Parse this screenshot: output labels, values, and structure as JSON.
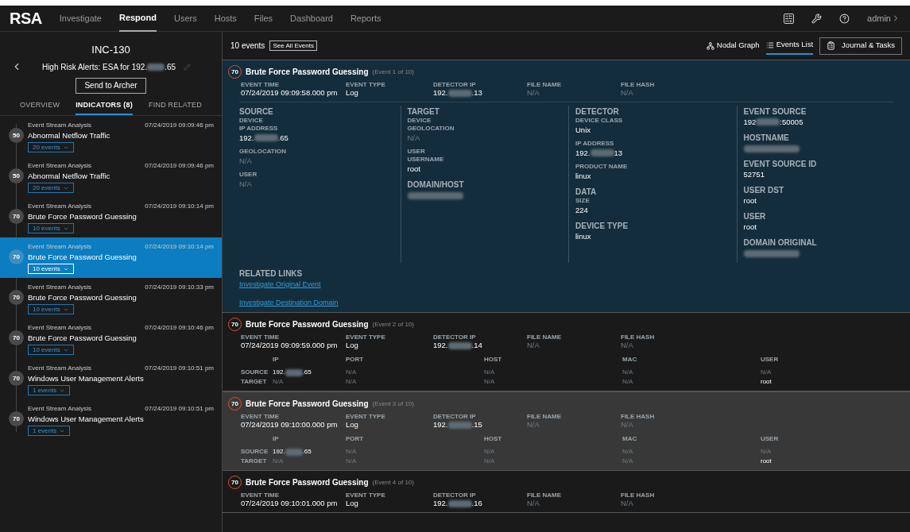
{
  "nav": {
    "logo": "RSA",
    "items": [
      {
        "label": "Investigate",
        "selected": false
      },
      {
        "label": "Respond",
        "selected": true
      },
      {
        "label": "Users",
        "selected": false
      },
      {
        "label": "Hosts",
        "selected": false
      },
      {
        "label": "Files",
        "selected": false
      },
      {
        "label": "Dashboard",
        "selected": false
      },
      {
        "label": "Reports",
        "selected": false
      }
    ],
    "user": "admin"
  },
  "incident": {
    "id": "INC-130",
    "title_prefix": "High Risk Alerts: ESA for 192.",
    "title_suffix": ".65",
    "button": "Send to Archer",
    "tabs": [
      {
        "label": "OVERVIEW",
        "selected": false
      },
      {
        "label": "INDICATORS (8)",
        "selected": true
      },
      {
        "label": "FIND RELATED",
        "selected": false
      }
    ]
  },
  "indicators": [
    {
      "source": "Event Stream Analysis",
      "time": "07/24/2019 09:09:46 pm",
      "score": "50",
      "name": "Abnormal Netflow Traffic",
      "events": "20 events",
      "selected": false
    },
    {
      "source": "Event Stream Analysis",
      "time": "07/24/2019 09:09:46 pm",
      "score": "50",
      "name": "Abnormal Netflow Traffic",
      "events": "20 events",
      "selected": false
    },
    {
      "source": "Event Stream Analysis",
      "time": "07/24/2019 09:10:14 pm",
      "score": "70",
      "name": "Brute Force Password Guessing",
      "events": "10 events",
      "selected": false
    },
    {
      "source": "Event Stream Analysis",
      "time": "07/24/2019 09:10:14 pm",
      "score": "70",
      "name": "Brute Force Password Guessing",
      "events": "10 events",
      "selected": true
    },
    {
      "source": "Event Stream Analysis",
      "time": "07/24/2019 09:10:33 pm",
      "score": "70",
      "name": "Brute Force Password Guessing",
      "events": "10 events",
      "selected": false
    },
    {
      "source": "Event Stream Analysis",
      "time": "07/24/2019 09:10:46 pm",
      "score": "70",
      "name": "Brute Force Password Guessing",
      "events": "10 events",
      "selected": false
    },
    {
      "source": "Event Stream Analysis",
      "time": "07/24/2019 09:10:51 pm",
      "score": "70",
      "name": "Windows User Management Alerts",
      "events": "1 events",
      "selected": false
    },
    {
      "source": "Event Stream Analysis",
      "time": "07/24/2019 09:10:51 pm",
      "score": "70",
      "name": "Windows User Management Alerts",
      "events": "1 events",
      "selected": false
    }
  ],
  "events_header": {
    "count": "10 events",
    "see_all": "See All Events",
    "views": [
      {
        "label": "Nodal Graph",
        "kind": "graph",
        "selected": false
      },
      {
        "label": "Events List",
        "kind": "list",
        "selected": true
      }
    ],
    "journal": "Journal & Tasks"
  },
  "events": [
    {
      "score": "70",
      "title": "Brute Force Password Guessing",
      "position": "(Event 1 of 10)",
      "expanded": true,
      "highlighted": false,
      "fields": [
        {
          "label": "EVENT TIME",
          "value": {
            "kind": "value",
            "text": "07/24/2019 09:09:58.000 pm"
          }
        },
        {
          "label": "EVENT TYPE",
          "value": {
            "kind": "value",
            "text": "Log"
          }
        },
        {
          "label": "DETECTOR IP",
          "value": {
            "kind": "ip",
            "prefix": "192.",
            "suffix": ".13"
          }
        },
        {
          "label": "FILE NAME",
          "value": {
            "kind": "na",
            "text": "N/A"
          }
        },
        {
          "label": "FILE HASH",
          "value": {
            "kind": "na",
            "text": "N/A"
          }
        }
      ],
      "details": [
        [
          {
            "kind": "section",
            "text": "SOURCE"
          },
          {
            "kind": "label",
            "text": "DEVICE"
          },
          {
            "kind": "label",
            "text": "IP ADDRESS"
          },
          {
            "kind": "ip",
            "prefix": "192.",
            "suffix": ".65"
          },
          {
            "kind": "label",
            "text": "GEOLOCATION"
          },
          {
            "kind": "na",
            "text": "N/A"
          },
          {
            "kind": "label",
            "text": "USER"
          },
          {
            "kind": "na",
            "text": "N/A"
          }
        ],
        [
          {
            "kind": "section",
            "text": "TARGET"
          },
          {
            "kind": "label",
            "text": "DEVICE"
          },
          {
            "kind": "label",
            "text": "GEOLOCATION"
          },
          {
            "kind": "na",
            "text": "N/A"
          },
          {
            "kind": "label",
            "text": "USER"
          },
          {
            "kind": "label",
            "text": "USERNAME"
          },
          {
            "kind": "value",
            "text": "root"
          },
          {
            "kind": "section",
            "text": "DOMAIN/HOST"
          },
          {
            "kind": "blur"
          }
        ],
        [
          {
            "kind": "section",
            "text": "DETECTOR"
          },
          {
            "kind": "label",
            "text": "DEVICE CLASS"
          },
          {
            "kind": "value",
            "text": "Unix"
          },
          {
            "kind": "label",
            "text": "IP ADDRESS"
          },
          {
            "kind": "ip",
            "prefix": "192.",
            "suffix": "13"
          },
          {
            "kind": "label",
            "text": "PRODUCT NAME"
          },
          {
            "kind": "value",
            "text": "linux"
          },
          {
            "kind": "section",
            "text": "DATA"
          },
          {
            "kind": "label",
            "text": "SIZE"
          },
          {
            "kind": "value",
            "text": "224"
          },
          {
            "kind": "section",
            "text": "DEVICE TYPE"
          },
          {
            "kind": "value",
            "text": "linux"
          }
        ],
        [
          {
            "kind": "section",
            "text": "EVENT SOURCE"
          },
          {
            "kind": "ip",
            "prefix": "192",
            "suffix": ":50005"
          },
          {
            "kind": "section",
            "text": "HOSTNAME"
          },
          {
            "kind": "blur"
          },
          {
            "kind": "section",
            "text": "EVENT SOURCE ID"
          },
          {
            "kind": "value",
            "text": "52751"
          },
          {
            "kind": "section",
            "text": "USER DST"
          },
          {
            "kind": "value",
            "text": "root"
          },
          {
            "kind": "section",
            "text": "USER"
          },
          {
            "kind": "value",
            "text": "root"
          },
          {
            "kind": "section",
            "text": "DOMAIN ORIGINAL"
          },
          {
            "kind": "blur"
          }
        ]
      ],
      "links_title": "RELATED LINKS",
      "links": [
        "Investigate Original Event",
        "Investigate Destination Domain"
      ]
    },
    {
      "score": "70",
      "title": "Brute Force Password Guessing",
      "position": "(Event 2 of 10)",
      "expanded": false,
      "highlighted": false,
      "fields": [
        {
          "label": "EVENT TIME",
          "value": {
            "kind": "value",
            "text": "07/24/2019 09:09:59.000 pm"
          }
        },
        {
          "label": "EVENT TYPE",
          "value": {
            "kind": "value",
            "text": "Log"
          }
        },
        {
          "label": "DETECTOR IP",
          "value": {
            "kind": "ip",
            "prefix": "192.",
            "suffix": ".14"
          }
        },
        {
          "label": "FILE NAME",
          "value": {
            "kind": "na",
            "text": "N/A"
          }
        },
        {
          "label": "FILE HASH",
          "value": {
            "kind": "na",
            "text": "N/A"
          }
        }
      ],
      "table": {
        "columns": [
          "IP",
          "PORT",
          "HOST",
          "MAC",
          "USER"
        ],
        "rows": [
          {
            "label": "SOURCE",
            "cells": [
              {
                "kind": "ip",
                "prefix": "192.",
                "suffix": ".65"
              },
              {
                "kind": "na",
                "text": "N/A"
              },
              {
                "kind": "na",
                "text": "N/A"
              },
              {
                "kind": "na",
                "text": "N/A"
              },
              {
                "kind": "na",
                "text": "N/A"
              }
            ]
          },
          {
            "label": "TARGET",
            "cells": [
              {
                "kind": "na",
                "text": "N/A"
              },
              {
                "kind": "na",
                "text": "N/A"
              },
              {
                "kind": "na",
                "text": "N/A"
              },
              {
                "kind": "na",
                "text": "N/A"
              },
              {
                "kind": "value",
                "text": "root"
              }
            ]
          }
        ]
      }
    },
    {
      "score": "70",
      "title": "Brute Force Password Guessing",
      "position": "(Event 3 of 10)",
      "expanded": false,
      "highlighted": true,
      "fields": [
        {
          "label": "EVENT TIME",
          "value": {
            "kind": "value",
            "text": "07/24/2019 09:10:00.000 pm"
          }
        },
        {
          "label": "EVENT TYPE",
          "value": {
            "kind": "value",
            "text": "Log"
          }
        },
        {
          "label": "DETECTOR IP",
          "value": {
            "kind": "ip",
            "prefix": "192.",
            "suffix": ".15"
          }
        },
        {
          "label": "FILE NAME",
          "value": {
            "kind": "na",
            "text": "N/A"
          }
        },
        {
          "label": "FILE HASH",
          "value": {
            "kind": "na",
            "text": "N/A"
          }
        }
      ],
      "table": {
        "columns": [
          "IP",
          "PORT",
          "HOST",
          "MAC",
          "USER"
        ],
        "rows": [
          {
            "label": "SOURCE",
            "cells": [
              {
                "kind": "ip",
                "prefix": "192.",
                "suffix": ".65"
              },
              {
                "kind": "na",
                "text": "N/A"
              },
              {
                "kind": "na",
                "text": "N/A"
              },
              {
                "kind": "na",
                "text": "N/A"
              },
              {
                "kind": "na",
                "text": "N/A"
              }
            ]
          },
          {
            "label": "TARGET",
            "cells": [
              {
                "kind": "na",
                "text": "N/A"
              },
              {
                "kind": "na",
                "text": "N/A"
              },
              {
                "kind": "na",
                "text": "N/A"
              },
              {
                "kind": "na",
                "text": "N/A"
              },
              {
                "kind": "value",
                "text": "root"
              }
            ]
          }
        ]
      }
    },
    {
      "score": "70",
      "title": "Brute Force Password Guessing",
      "position": "(Event 4 of 10)",
      "expanded": false,
      "highlighted": false,
      "fields": [
        {
          "label": "EVENT TIME",
          "value": {
            "kind": "value",
            "text": "07/24/2019 09:10:01.000 pm"
          }
        },
        {
          "label": "EVENT TYPE",
          "value": {
            "kind": "value",
            "text": "Log"
          }
        },
        {
          "label": "DETECTOR IP",
          "value": {
            "kind": "ip",
            "prefix": "192.",
            "suffix": ".16"
          }
        },
        {
          "label": "FILE NAME",
          "value": {
            "kind": "na",
            "text": "N/A"
          }
        },
        {
          "label": "FILE HASH",
          "value": {
            "kind": "na",
            "text": "N/A"
          }
        }
      ]
    }
  ]
}
